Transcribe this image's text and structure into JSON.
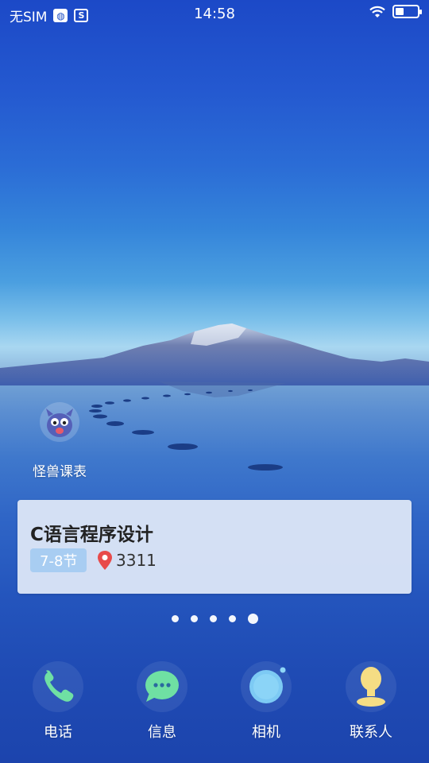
{
  "status_bar": {
    "carrier": "无SIM",
    "time": "14:58"
  },
  "widget": {
    "label": "怪兽课表",
    "icon": "monster-icon"
  },
  "course_card": {
    "title": "C语言程序设计",
    "period": "7-8节",
    "room": "3311"
  },
  "page_indicator": {
    "count": 5,
    "active_index": 4
  },
  "dock": {
    "items": [
      {
        "label": "电话",
        "icon": "phone-icon"
      },
      {
        "label": "信息",
        "icon": "message-icon"
      },
      {
        "label": "相机",
        "icon": "camera-icon"
      },
      {
        "label": "联系人",
        "icon": "contacts-icon"
      }
    ]
  },
  "colors": {
    "phone": "#6fe0a3",
    "message": "#6fe0a3",
    "camera": "#7dcaf4",
    "contacts": "#f5dd84",
    "badge": "#a8cdf2",
    "pin": "#e84a4a"
  }
}
